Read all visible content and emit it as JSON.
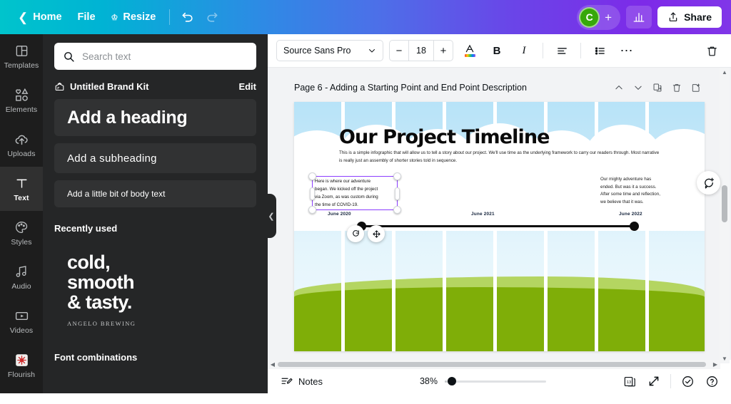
{
  "topbar": {
    "back_icon": "chevron-left-icon",
    "home_label": "Home",
    "file_label": "File",
    "resize_label": "Resize",
    "resize_icon": "crown-icon",
    "undo_icon": "undo-icon",
    "redo_icon": "redo-icon",
    "avatar_initial": "C",
    "avatar_color": "#37a80a",
    "add_people_icon": "plus-icon",
    "stats_icon": "bar-chart-icon",
    "share_label": "Share",
    "share_icon": "upload-icon",
    "gradient_start": "#00c4cc",
    "gradient_end": "#7d2ae8"
  },
  "rail": {
    "items": [
      {
        "label": "Templates",
        "icon": "templates-icon",
        "active": false
      },
      {
        "label": "Elements",
        "icon": "elements-icon",
        "active": false
      },
      {
        "label": "Uploads",
        "icon": "upload-cloud-icon",
        "active": false
      },
      {
        "label": "Text",
        "icon": "text-t-icon",
        "active": true
      },
      {
        "label": "Styles",
        "icon": "palette-icon",
        "active": false
      },
      {
        "label": "Audio",
        "icon": "music-note-icon",
        "active": false
      },
      {
        "label": "Videos",
        "icon": "video-play-icon",
        "active": false
      },
      {
        "label": "Flourish",
        "icon": "flourish-logo-icon",
        "active": false
      }
    ]
  },
  "panel": {
    "search": {
      "placeholder": "Search text",
      "value": "",
      "icon": "search-icon"
    },
    "brand_kit": {
      "icon": "brand-kit-icon",
      "title": "Untitled Brand Kit",
      "edit_label": "Edit"
    },
    "text_cards": [
      {
        "label": "Add a heading",
        "style": "heading"
      },
      {
        "label": "Add a subheading",
        "style": "subheading"
      },
      {
        "label": "Add a little bit of body text",
        "style": "body"
      }
    ],
    "recently_used_title": "Recently used",
    "recent_item": {
      "line1": "cold,",
      "line2": "smooth",
      "line3": "& tasty.",
      "caption": "ANGELO BREWING"
    },
    "font_combinations_title": "Font combinations",
    "collapse_icon": "chevron-left-icon"
  },
  "toolbar": {
    "font_family": "Source Sans Pro",
    "font_dropdown_icon": "chevron-down-icon",
    "font_size_decrease": "−",
    "font_size": "18",
    "font_size_increase": "+",
    "text_color_icon": "text-color-A-icon",
    "bold_label": "B",
    "italic_label": "I",
    "align_icon": "align-left-icon",
    "list_icon": "bulleted-list-icon",
    "more_icon": "more-horizontal-icon",
    "delete_icon": "trash-icon"
  },
  "page_header": {
    "title": "Page 6 - Adding a Starting Point and End Point Description",
    "controls": [
      {
        "icon": "chevron-up-icon",
        "name": "move-page-up"
      },
      {
        "icon": "chevron-down-icon",
        "name": "move-page-down"
      },
      {
        "icon": "duplicate-page-icon",
        "name": "duplicate-page"
      },
      {
        "icon": "trash-icon",
        "name": "delete-page"
      },
      {
        "icon": "add-page-icon",
        "name": "add-page"
      }
    ]
  },
  "design": {
    "title": "Our Project Timeline",
    "body": "This is a simple infographic that will allow us to tell a story about our project.  We'll use time as the underlying framework to carry our readers through.  Most narrative is really just an assembly of shorter stories told in sequence.",
    "selected_text": {
      "line1": "Here is  where our adventure",
      "line2": "began.  We kicked off the project",
      "line3": "via Zoom, as was custom during",
      "line4": "the time of COVID-19.",
      "selection_color": "#8b3dff"
    },
    "right_text": {
      "line1": "Our mighty adventure has",
      "line2": "ended.  But was it a success.",
      "line3": "After some time and reflection,",
      "line4": "we believe that it was."
    },
    "dates": {
      "start": "June 2020",
      "middle": "June 2021",
      "end": "June 2022"
    },
    "colors": {
      "sky": "#b7e3f8",
      "hill_back": "#b4d561",
      "hill_front": "#7fae08",
      "cloud": "#ffffff"
    },
    "float_buttons": [
      {
        "icon": "rotate-icon",
        "name": "rotate-handle"
      },
      {
        "icon": "move-icon",
        "name": "move-handle"
      }
    ]
  },
  "comment_fab": {
    "icon": "add-comment-icon"
  },
  "bottombar": {
    "notes_label": "Notes",
    "notes_icon": "notes-icon",
    "zoom_percent": "38%",
    "pages_icon": "page-manager-icon",
    "pages_badge": "13",
    "fullscreen_icon": "expand-icon",
    "status_icon": "check-circle-icon",
    "help_icon": "help-circle-icon",
    "collapse_icon": "chevron-up-icon"
  },
  "scrollbars": {
    "v_up_icon": "scroll-up-icon",
    "v_down_icon": "scroll-down-icon",
    "h_left_icon": "scroll-left-icon",
    "h_right_icon": "scroll-right-icon"
  }
}
